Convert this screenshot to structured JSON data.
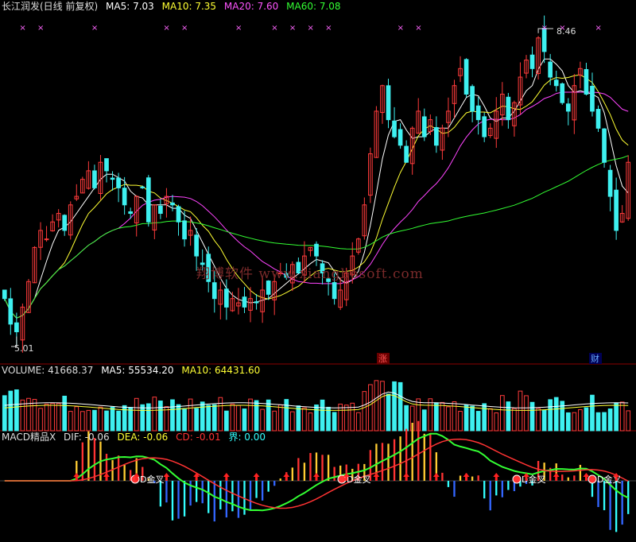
{
  "colors": {
    "up": "#ff3b3b",
    "down": "#3ef0f0",
    "ma5": "#ffffff",
    "ma10": "#ffff33",
    "ma20": "#ff44ff",
    "ma60": "#33ff33",
    "grid": "#8b0000",
    "label": "#dddddd",
    "pink": "#ff66ff",
    "cyan": "#33ffff",
    "red": "#ff3333"
  },
  "header": {
    "title": "长江润发(日线 前复权)",
    "ma5": "MA5: 7.03",
    "ma10": "MA10: 7.35",
    "ma20": "MA20: 7.60",
    "ma60": "MA60: 7.08"
  },
  "price_panel": {
    "high_label": "8.46",
    "low_label": "5.01",
    "badge_zhang": "涨",
    "badge_cai": "财",
    "watermark": "翔博软件 www.xiangbosoft.com"
  },
  "volume_panel": {
    "volume": "VOLUME: 41668.37",
    "ma5": "MA5: 55534.20",
    "ma10": "MA10: 64431.60"
  },
  "macd_panel": {
    "name": "MACD精品X",
    "dif": "DIF: -0.06",
    "dea": "DEA: -0.06",
    "cd": "CD: -0.01",
    "jie": "界: 0.00",
    "cross_labels": [
      "D金叉",
      "D金叉",
      "D金叉",
      "D金叉"
    ]
  },
  "chart_data": {
    "type": "candlestick",
    "title": "长江润发(日线 前复权)",
    "ylim": [
      4.8,
      8.7
    ],
    "bars": 105,
    "closes": [
      5.4,
      5.1,
      5.01,
      5.3,
      5.6,
      6.0,
      6.2,
      6.1,
      6.3,
      6.4,
      6.2,
      6.5,
      6.6,
      6.8,
      6.9,
      6.7,
      7.0,
      6.9,
      6.8,
      6.7,
      6.5,
      6.4,
      6.6,
      6.7,
      6.3,
      6.5,
      6.4,
      6.6,
      6.5,
      6.3,
      6.1,
      6.2,
      5.9,
      5.8,
      5.6,
      5.4,
      5.5,
      5.3,
      5.4,
      5.35,
      5.3,
      5.4,
      5.35,
      5.5,
      5.45,
      5.6,
      5.7,
      5.65,
      5.8,
      5.7,
      5.9,
      6.0,
      5.9,
      5.7,
      5.6,
      5.4,
      5.5,
      5.7,
      5.9,
      6.1,
      6.5,
      7.1,
      7.6,
      7.9,
      7.5,
      7.3,
      7.2,
      7.0,
      7.4,
      7.6,
      7.3,
      7.5,
      7.2,
      7.4,
      7.6,
      7.9,
      8.1,
      7.8,
      7.6,
      7.5,
      7.3,
      7.4,
      7.6,
      7.8,
      7.5,
      7.7,
      8.0,
      8.2,
      8.1,
      8.46,
      8.3,
      8.0,
      7.9,
      7.7,
      7.6,
      7.9,
      8.1,
      7.8,
      7.6,
      7.4,
      7.0,
      6.6,
      6.2,
      6.4,
      7.0
    ]
  }
}
